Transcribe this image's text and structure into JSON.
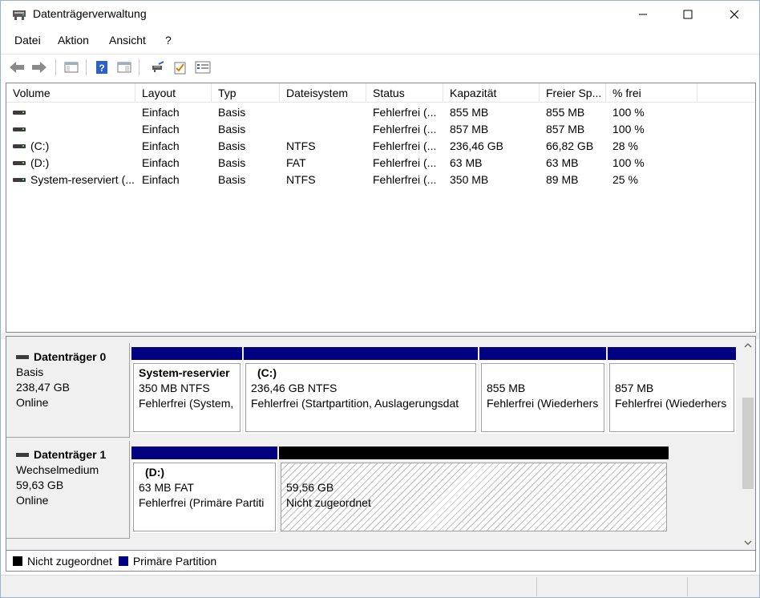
{
  "window": {
    "title": "Datenträgerverwaltung",
    "minimize": "minimize-icon",
    "maximize": "maximize-icon",
    "close": "close-icon"
  },
  "menu": [
    "Datei",
    "Aktion",
    "Ansicht",
    "?"
  ],
  "toolbar": [
    "back-arrow-icon",
    "forward-arrow-icon",
    "console-tree-icon",
    "help-icon",
    "properties-icon",
    "connect-icon",
    "checklist-icon",
    "settings-list-icon"
  ],
  "volume_list": {
    "columns": [
      "Volume",
      "Layout",
      "Typ",
      "Dateisystem",
      "Status",
      "Kapazität",
      "Freier Sp...",
      "% frei"
    ],
    "rows": [
      {
        "volume": "",
        "layout": "Einfach",
        "typ": "Basis",
        "fs": "",
        "status": "Fehlerfrei (...",
        "cap": "855 MB",
        "free": "855 MB",
        "pct": "100 %"
      },
      {
        "volume": "",
        "layout": "Einfach",
        "typ": "Basis",
        "fs": "",
        "status": "Fehlerfrei (...",
        "cap": "857 MB",
        "free": "857 MB",
        "pct": "100 %"
      },
      {
        "volume": "(C:)",
        "layout": "Einfach",
        "typ": "Basis",
        "fs": "NTFS",
        "status": "Fehlerfrei (...",
        "cap": "236,46 GB",
        "free": "66,82 GB",
        "pct": "28 %"
      },
      {
        "volume": "(D:)",
        "layout": "Einfach",
        "typ": "Basis",
        "fs": "FAT",
        "status": "Fehlerfrei (...",
        "cap": "63 MB",
        "free": "63 MB",
        "pct": "100 %"
      },
      {
        "volume": "System-reserviert (...",
        "layout": "Einfach",
        "typ": "Basis",
        "fs": "NTFS",
        "status": "Fehlerfrei (...",
        "cap": "350 MB",
        "free": "89 MB",
        "pct": "25 %"
      }
    ]
  },
  "disks": [
    {
      "name": "Datenträger 0",
      "type": "Basis",
      "size": "238,47 GB",
      "state": "Online",
      "partitions": [
        {
          "title": "System-reservier",
          "size": "350 MB NTFS",
          "status": "Fehlerfrei (System,"
        },
        {
          "title": "(C:)",
          "size": "236,46 GB NTFS",
          "status": "Fehlerfrei (Startpartition, Auslagerungsdat"
        },
        {
          "title": "",
          "size": "855 MB",
          "status": "Fehlerfrei (Wiederhers"
        },
        {
          "title": "",
          "size": "857 MB",
          "status": "Fehlerfrei (Wiederhers"
        }
      ]
    },
    {
      "name": "Datenträger 1",
      "type": "Wechselmedium",
      "size": "59,63 GB",
      "state": "Online",
      "partitions": [
        {
          "title": "(D:)",
          "size": "63 MB FAT",
          "status": "Fehlerfrei (Primäre Partiti"
        },
        {
          "title": "",
          "size": "59,56 GB",
          "status": "Nicht zugeordnet"
        }
      ]
    }
  ],
  "legend": [
    {
      "label": "Nicht zugeordnet",
      "color": "#000000"
    },
    {
      "label": "Primäre Partition",
      "color": "#000080"
    }
  ],
  "colors": {
    "primary": "#000080",
    "unallocated": "#000000"
  }
}
